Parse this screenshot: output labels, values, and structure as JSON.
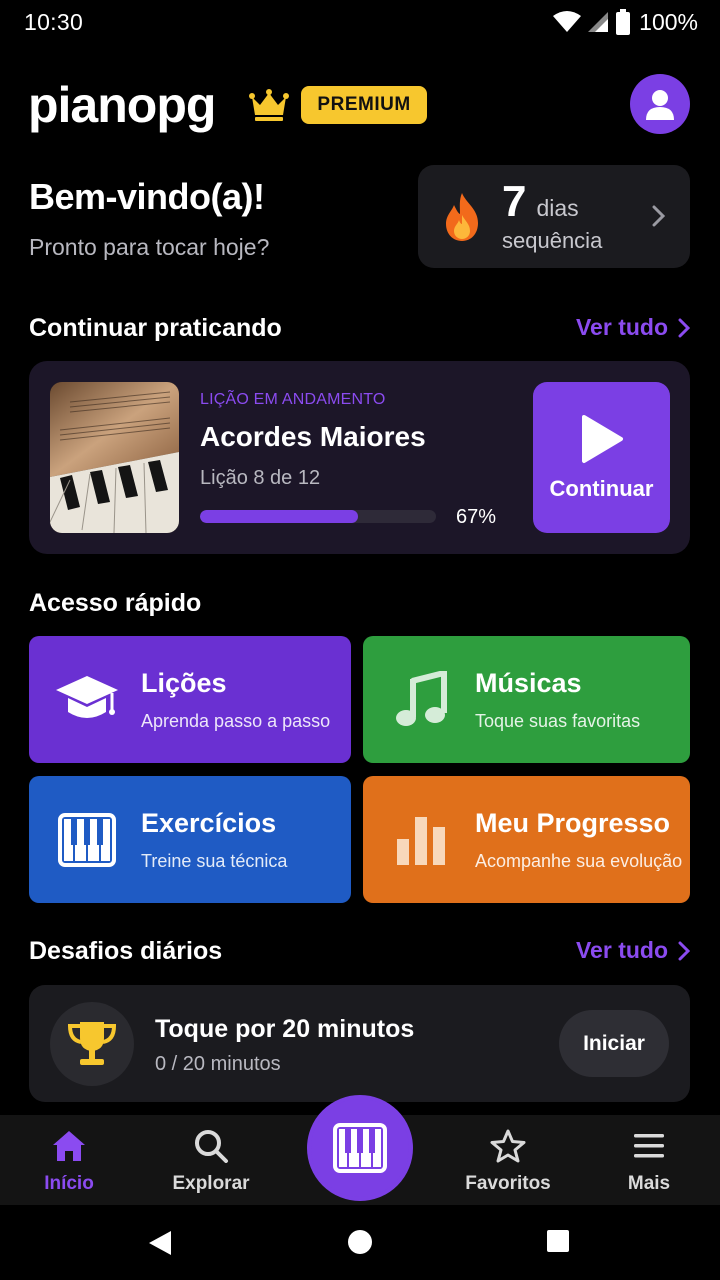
{
  "status_bar": {
    "time": "10:30",
    "battery": "100%"
  },
  "header": {
    "app_name": "pianopg",
    "badge": "PREMIUM"
  },
  "welcome": {
    "title": "Bem-vindo(a)!",
    "subtitle": "Pronto para tocar hoje?"
  },
  "streak": {
    "count": "7",
    "unit": "dias",
    "label": "sequência"
  },
  "continue_section": {
    "title": "Continuar praticando",
    "see_all": "Ver tudo",
    "lesson_tag": "LIÇÃO EM ANDAMENTO",
    "lesson_name": "Acordes Maiores",
    "lesson_count": "Lição 8 de 12",
    "progress": 0.67,
    "progress_label": "67%",
    "button_label": "Continuar"
  },
  "quick_access": {
    "title": "Acesso rápido",
    "tiles": [
      {
        "title": "Lições",
        "subtitle": "Aprenda passo a passo",
        "icon": "graduation-cap-icon",
        "color": "#6A30D2"
      },
      {
        "title": "Músicas",
        "subtitle": "Toque suas favoritas",
        "icon": "music-note-icon",
        "color": "#2E9E3E"
      },
      {
        "title": "Exercícios",
        "subtitle": "Treine sua técnica",
        "icon": "piano-keys-icon",
        "color": "#1F5BC4"
      },
      {
        "title": "Meu Progresso",
        "subtitle": "Acompanhe sua evolução",
        "icon": "bar-chart-icon",
        "color": "#E0701B"
      }
    ]
  },
  "challenges": {
    "title": "Desafios diários",
    "see_all": "Ver tudo",
    "item": {
      "title": "Toque por 20 minutos",
      "subtitle": "0 / 20 minutos",
      "button": "Iniciar",
      "icon": "trophy-icon"
    }
  },
  "bottom_nav": {
    "items": [
      {
        "label": "Início",
        "icon": "home-icon",
        "active": true
      },
      {
        "label": "Explorar",
        "icon": "search-icon",
        "active": false
      },
      {
        "label": "Favoritos",
        "icon": "star-icon",
        "active": false
      },
      {
        "label": "Mais",
        "icon": "menu-icon",
        "active": false
      }
    ],
    "center_icon": "piano-keys-icon"
  },
  "colors": {
    "accent": "#7B3FE4",
    "accent_text": "#8B4BF0",
    "premium": "#F7C72E"
  }
}
